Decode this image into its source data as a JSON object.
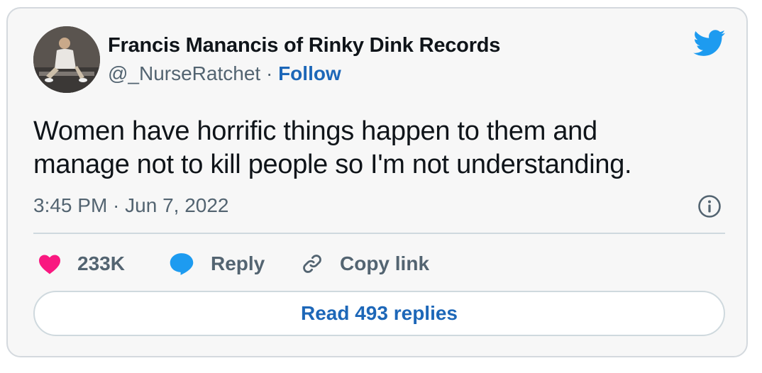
{
  "author": {
    "display_name": "Francis Manancis of Rinky Dink Records",
    "handle": "@_NurseRatchet",
    "separator": "·",
    "follow_label": "Follow"
  },
  "tweet": {
    "text_line1": "Women have horrific things happen to them and",
    "text_line2": "manage not to kill people so I'm not understanding.",
    "timestamp": "3:45 PM · Jun 7, 2022"
  },
  "actions": {
    "like_count": "233K",
    "reply_label": "Reply",
    "copy_link_label": "Copy link"
  },
  "read_replies_label": "Read 493 replies",
  "icons": {
    "brand": "twitter-bird-icon",
    "like": "heart-icon",
    "reply": "speech-bubble-icon",
    "copy": "link-icon",
    "info": "info-icon"
  },
  "colors": {
    "twitter_blue": "#1d9bf0",
    "link_blue": "#1d67b8",
    "like_pink": "#f91880",
    "muted_text": "#536471",
    "card_background": "#f7f7f7"
  }
}
